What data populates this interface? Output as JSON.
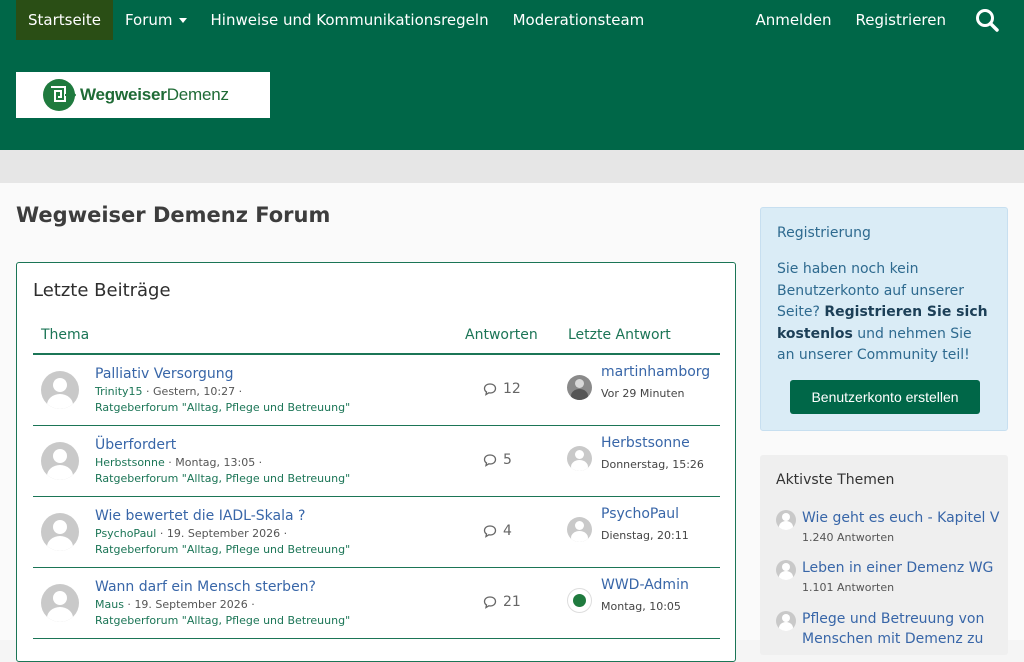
{
  "nav": {
    "items": [
      {
        "label": "Startseite",
        "active": true
      },
      {
        "label": "Forum",
        "dropdown": true
      },
      {
        "label": "Hinweise und Kommunikationsregeln"
      },
      {
        "label": "Moderationsteam"
      }
    ],
    "login": "Anmelden",
    "register": "Registrieren"
  },
  "logo": {
    "part1": "Wegweiser",
    "part2": "Demenz"
  },
  "page_title": "Wegweiser Demenz Forum",
  "latest": {
    "title": "Letzte Beiträge",
    "columns": {
      "topic": "Thema",
      "replies": "Antworten",
      "last": "Letzte Antwort"
    },
    "rows": [
      {
        "title": "Palliativ Versorgung",
        "author": "Trinity15",
        "date": "Gestern, 10:27",
        "forum": "Ratgeberforum \"Alltag, Pflege und Betreuung\"",
        "replies": "12",
        "last_user": "martinhamborg",
        "last_time": "Vor 29 Minuten",
        "last_avatar": "photo"
      },
      {
        "title": "Überfordert",
        "author": "Herbstsonne",
        "date": "Montag, 13:05",
        "forum": "Ratgeberforum \"Alltag, Pflege und Betreuung\"",
        "replies": "5",
        "last_user": "Herbstsonne",
        "last_time": "Donnerstag, 15:26",
        "last_avatar": "default"
      },
      {
        "title": "Wie bewertet die IADL-Skala ?",
        "author": "PsychoPaul",
        "date": "19. September 2026",
        "forum": "Ratgeberforum \"Alltag, Pflege und Betreuung\"",
        "replies": "4",
        "last_user": "PsychoPaul",
        "last_time": "Dienstag, 20:11",
        "last_avatar": "default"
      },
      {
        "title": "Wann darf ein Mensch sterben?",
        "author": "Maus",
        "date": "19. September 2026",
        "forum": "Ratgeberforum \"Alltag, Pflege und Betreuung\"",
        "replies": "21",
        "last_user": "WWD-Admin",
        "last_time": "Montag, 10:05",
        "last_avatar": "admin"
      }
    ]
  },
  "registration": {
    "title": "Registrierung",
    "text_before": "Sie haben noch kein Benutzerkonto auf unserer Seite? ",
    "text_bold": "Registrieren Sie sich kostenlos",
    "text_after": " und nehmen Sie an unserer Community teil!",
    "button": "Benutzerkonto erstellen"
  },
  "active_topics": {
    "title": "Aktivste Themen",
    "items": [
      {
        "title": "Wie geht es euch - Kapitel V",
        "count": "1.240 Antworten"
      },
      {
        "title": "Leben in einer Demenz WG",
        "count": "1.101 Antworten"
      },
      {
        "title": "Pflege und Betreuung von Menschen mit Demenz zu",
        "count": ""
      }
    ]
  },
  "colors": {
    "primary": "#006748",
    "active_nav": "#2a4e15",
    "link": "#3866a8",
    "accent": "#1b7556"
  },
  "icons": [
    "search-icon",
    "caret-down-icon",
    "comment-icon",
    "avatar-icon",
    "logo-icon"
  ]
}
